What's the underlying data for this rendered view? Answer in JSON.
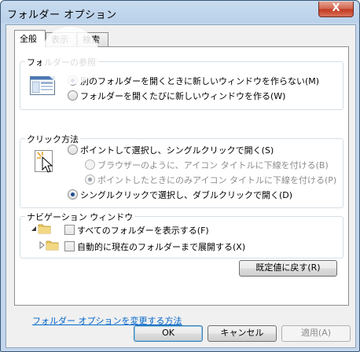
{
  "window": {
    "title": "フォルダー オプション",
    "close_label": "X"
  },
  "tabs": [
    {
      "label": "全般",
      "active": true
    },
    {
      "label": "表示",
      "active": false
    },
    {
      "label": "検索",
      "active": false
    }
  ],
  "browse_folders": {
    "title": "フォルダーの参照",
    "options": [
      {
        "label": "別のフォルダーを開くときに新しいウィンドウを作らない(M)",
        "checked": true
      },
      {
        "label": "フォルダーを開くたびに新しいウィンドウを作る(W)",
        "checked": false
      }
    ]
  },
  "click_items": {
    "title": "クリック方法",
    "options": [
      {
        "label": "ポイントして選択し、シングルクリックで開く(S)",
        "checked": false
      },
      {
        "label": "ブラウザーのように、アイコン タイトルに下線を付ける(B)",
        "checked": false,
        "disabled": true
      },
      {
        "label": "ポイントしたときにのみアイコン タイトルに下線を付ける(P)",
        "checked": true,
        "disabled": true
      },
      {
        "label": "シングルクリックで選択し、ダブルクリックで開く(D)",
        "checked": true
      }
    ]
  },
  "navigation_pane": {
    "title": "ナビゲーション ウィンドウ",
    "options": [
      {
        "label": "すべてのフォルダーを表示する(F)",
        "checked": false
      },
      {
        "label": "自動的に現在のフォルダーまで展開する(X)",
        "checked": false
      }
    ]
  },
  "restore_defaults_label": "既定値に戻す(R)",
  "help_link": "フォルダー オプションを変更する方法",
  "footer": {
    "ok": "OK",
    "cancel": "キャンセル",
    "apply": "適用(A)"
  },
  "colors": {
    "accent": "#1f4e8f",
    "link": "#0066cc",
    "close": "#c23b22"
  }
}
